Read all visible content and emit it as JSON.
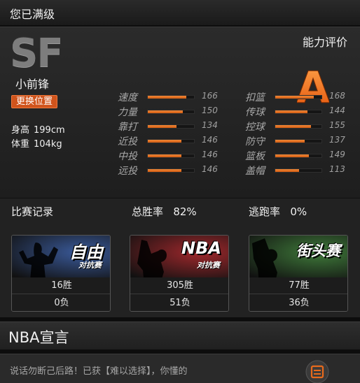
{
  "header": {
    "title": "您已满级"
  },
  "profile": {
    "position_abbr": "SF",
    "position_name": "小前锋",
    "change_button": "更换位置",
    "height_label": "身高",
    "height_value": "199cm",
    "weight_label": "体重",
    "weight_value": "104kg",
    "rating_label": "能力评价",
    "rating_grade": "A"
  },
  "stats_left": [
    {
      "name": "速度",
      "value": "166",
      "fill": 0.83
    },
    {
      "name": "力量",
      "value": "150",
      "fill": 0.75
    },
    {
      "name": "靠打",
      "value": "134",
      "fill": 0.62
    },
    {
      "name": "近投",
      "value": "146",
      "fill": 0.72
    },
    {
      "name": "中投",
      "value": "146",
      "fill": 0.72
    },
    {
      "name": "远投",
      "value": "146",
      "fill": 0.72
    }
  ],
  "stats_right": [
    {
      "name": "扣篮",
      "value": "168",
      "fill": 0.84
    },
    {
      "name": "传球",
      "value": "144",
      "fill": 0.7
    },
    {
      "name": "控球",
      "value": "155",
      "fill": 0.77
    },
    {
      "name": "防守",
      "value": "137",
      "fill": 0.64
    },
    {
      "name": "篮板",
      "value": "149",
      "fill": 0.73
    },
    {
      "name": "盖帽",
      "value": "113",
      "fill": 0.52
    }
  ],
  "records": {
    "title": "比赛记录",
    "win_rate_label": "总胜率",
    "win_rate_value": "82%",
    "flee_rate_label": "逃跑率",
    "flee_rate_value": "0%",
    "modes": [
      {
        "title": "自由",
        "subtitle": "对抗赛",
        "wins": "16胜",
        "losses": "0负",
        "color": "#3a5a9a"
      },
      {
        "title": "NBA",
        "subtitle": "对抗赛",
        "wins": "305胜",
        "losses": "51负",
        "color": "#a0282c"
      },
      {
        "title": "街头赛",
        "subtitle": "",
        "wins": "77胜",
        "losses": "36负",
        "color": "#3f7a3a"
      }
    ]
  },
  "manifesto": {
    "title": "NBA宣言",
    "text": "说话勿断己后路！已获【难以选择】，你懂的"
  }
}
